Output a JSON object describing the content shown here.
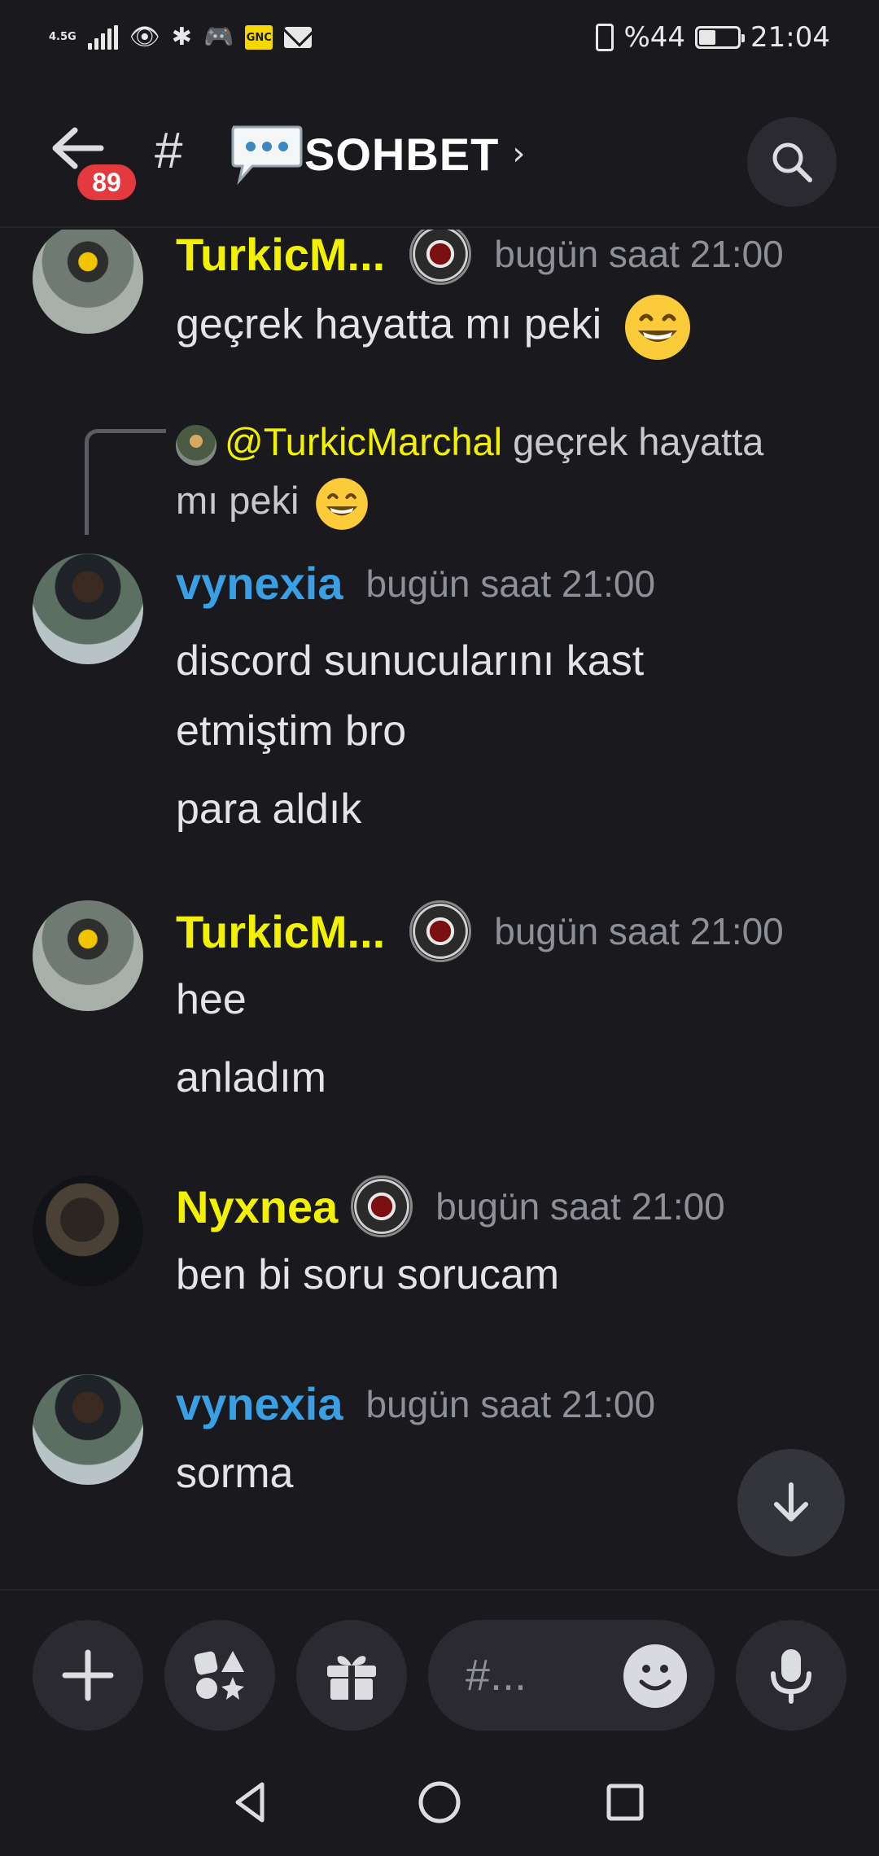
{
  "status_bar": {
    "network": "4.5G",
    "carrier_badge": "GNC",
    "battery": "%44",
    "time": "21:04"
  },
  "header": {
    "unread_count": "89",
    "channel_hash": "#",
    "channel_name": "SOHBET",
    "channel_emoji": "speech-balloon-icon"
  },
  "messages": [
    {
      "author": "TurkicM...",
      "author_color": "#f2f200",
      "has_role_icon": true,
      "time": "bugün saat 21:00",
      "lines": [
        "geçrek hayatta mı peki"
      ],
      "emoji": "grinning-face"
    },
    {
      "reply_to": {
        "mention": "@TurkicMarchal",
        "text_part1": "geçrek hayatta",
        "text_part2": "mı peki"
      },
      "author": "vynexia",
      "author_color": "#3aa0e6",
      "time": "bugün saat 21:00",
      "lines": [
        "discord sunucularını kast",
        "etmiştim bro",
        "para aldık"
      ]
    },
    {
      "author": "TurkicM...",
      "author_color": "#f2f200",
      "has_role_icon": true,
      "time": "bugün saat 21:00",
      "lines": [
        "hee",
        "anladım"
      ]
    },
    {
      "author": "Nyxnea",
      "author_color": "#f2f200",
      "has_role_icon": true,
      "time": "bugün saat 21:00",
      "lines": [
        "ben bi soru sorucam"
      ]
    },
    {
      "author": "vynexia",
      "author_color": "#3aa0e6",
      "time": "bugün saat 21:00",
      "lines": [
        "sorma"
      ]
    }
  ],
  "composer": {
    "placeholder": "#...",
    "buttons": [
      "plus-icon",
      "apps-icon",
      "gift-icon",
      "emoji-icon",
      "microphone-icon"
    ]
  },
  "colors": {
    "background": "#1a1a1e",
    "surface": "#2a2a30",
    "badge": "#e4393f",
    "username_yellow": "#f2f200",
    "username_blue": "#3aa0e6"
  }
}
